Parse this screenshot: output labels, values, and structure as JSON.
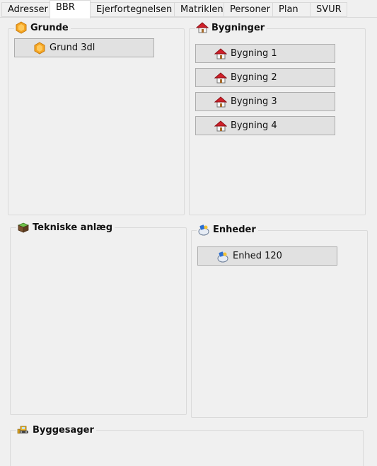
{
  "tabs": [
    {
      "label": "Adresser",
      "active": false
    },
    {
      "label": "BBR",
      "active": true
    },
    {
      "label": "Ejerfortegnelsen",
      "active": false
    },
    {
      "label": "Matriklen",
      "active": false
    },
    {
      "label": "Personer",
      "active": false
    },
    {
      "label": "Plan",
      "active": false
    },
    {
      "label": "SVUR",
      "active": false
    }
  ],
  "groups": {
    "grunde": {
      "title": "Grunde",
      "icon": "hexagon-icon",
      "items": [
        "Grund 3dl"
      ]
    },
    "bygninger": {
      "title": "Bygninger",
      "icon": "house-icon",
      "items": [
        "Bygning 1",
        "Bygning 2",
        "Bygning 3",
        "Bygning 4"
      ]
    },
    "tekniske": {
      "title": "Tekniske anlæg",
      "icon": "soil-block-icon",
      "items": []
    },
    "enheder": {
      "title": "Enheder",
      "icon": "unit-icon",
      "items": [
        "Enhed 120"
      ]
    },
    "byggesager": {
      "title": "Byggesager",
      "icon": "bulldozer-icon",
      "items": []
    }
  },
  "colors": {
    "background": "#f0f0f0",
    "button": "#e1e1e1",
    "button_border": "#adadad",
    "group_border": "#dadada",
    "hexagon": "#f5a623",
    "house_roof": "#d0202a"
  }
}
